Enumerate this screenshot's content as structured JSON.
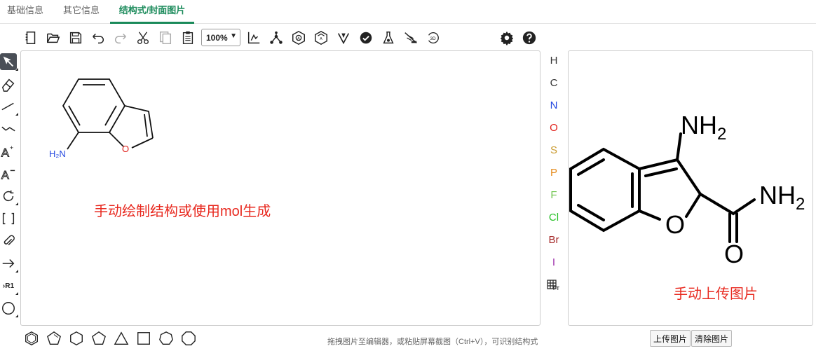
{
  "tabs": [
    {
      "label": "基础信息"
    },
    {
      "label": "其它信息"
    },
    {
      "label": "结构式/封面图片"
    }
  ],
  "toolbar": {
    "zoom": "100%",
    "icons": [
      "new-icon",
      "open-icon",
      "save-icon",
      "undo-icon",
      "redo-icon",
      "cut-icon",
      "copy-icon",
      "paste-icon",
      "zoom-select",
      "layout-icon",
      "clean-icon",
      "aromatize-icon",
      "dearomatize-icon",
      "stereo-icon",
      "check-icon",
      "analyze-icon",
      "recognize-icon",
      "3d-icon",
      "settings-icon",
      "help-icon"
    ]
  },
  "canvas": {
    "note": "手动绘制结构或使用mol生成",
    "molecule": {
      "nh2_label": "H₂N",
      "o_label": "O"
    }
  },
  "elements": [
    {
      "symbol": "H",
      "color": "#111111"
    },
    {
      "symbol": "C",
      "color": "#111111"
    },
    {
      "symbol": "N",
      "color": "#2448e0"
    },
    {
      "symbol": "O",
      "color": "#e0201a"
    },
    {
      "symbol": "S",
      "color": "#c99a2e"
    },
    {
      "symbol": "P",
      "color": "#e48a1a"
    },
    {
      "symbol": "F",
      "color": "#6cc34a"
    },
    {
      "symbol": "Cl",
      "color": "#27c027"
    },
    {
      "symbol": "Br",
      "color": "#a52a2a"
    },
    {
      "symbol": "I",
      "color": "#9d2eaa"
    },
    {
      "symbol": "PT",
      "color": "#111111"
    }
  ],
  "image_panel": {
    "note": "手动上传图片",
    "molecule": {
      "nh2_top": "NH",
      "nh2_top_sub": "2",
      "nh2_right": "NH",
      "nh2_right_sub": "2",
      "o_ring": "O",
      "o_carbonyl": "O"
    }
  },
  "hint": "拖拽图片至编辑器，或粘贴屏幕截图（Ctrl+V），可识别结构式",
  "buttons": {
    "upload": "上传图片",
    "clear": "清除图片"
  },
  "left_tools": {
    "r1_label": "R1"
  }
}
